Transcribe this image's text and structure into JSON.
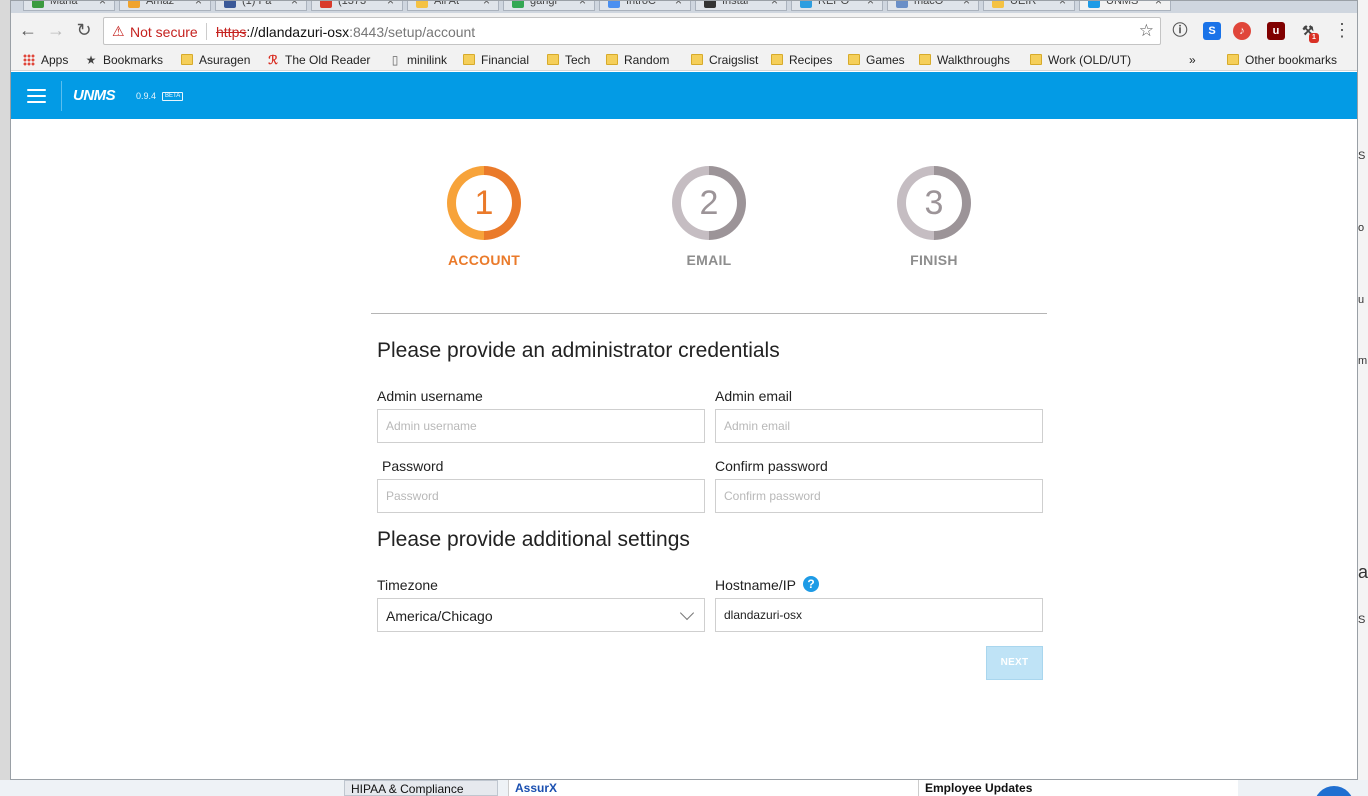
{
  "browser": {
    "tabs": [
      {
        "title": "Mana",
        "color": "#3b9b3f"
      },
      {
        "title": "Amaz",
        "color": "#f0a32c"
      },
      {
        "title": "(1) Fa",
        "color": "#3b5998"
      },
      {
        "title": "(1373",
        "color": "#d93a2b"
      },
      {
        "title": "All At",
        "color": "#f5c242"
      },
      {
        "title": "gangr",
        "color": "#34a853"
      },
      {
        "title": "IntroC",
        "color": "#4a8ff0"
      },
      {
        "title": "Instal",
        "color": "#333333"
      },
      {
        "title": "REPO",
        "color": "#2d9ee0"
      },
      {
        "title": "macO",
        "color": "#6a8fc7"
      },
      {
        "title": "UEIR",
        "color": "#f5c242"
      },
      {
        "title": "UNMS",
        "color": "#1e9be6"
      }
    ],
    "security_label": "Not secure",
    "url": {
      "protocol": "https",
      "separator": "://",
      "host": "dlandazuri-osx",
      "path": ":8443/setup/account"
    },
    "extension_badge": "1",
    "bookmarks": [
      {
        "label": "Apps",
        "icon": "apps-grid-icon"
      },
      {
        "label": "Bookmarks",
        "icon": "star-icon"
      },
      {
        "label": "Asuragen",
        "icon": "folder-icon"
      },
      {
        "label": "The Old Reader",
        "icon": "old-reader-icon"
      },
      {
        "label": "minilink",
        "icon": "page-icon"
      },
      {
        "label": "Financial",
        "icon": "folder-icon"
      },
      {
        "label": "Tech",
        "icon": "folder-icon"
      },
      {
        "label": "Random",
        "icon": "folder-icon"
      },
      {
        "label": "Craigslist",
        "icon": "folder-icon"
      },
      {
        "label": "Recipes",
        "icon": "folder-icon"
      },
      {
        "label": "Games",
        "icon": "folder-icon"
      },
      {
        "label": "Walkthroughs",
        "icon": "folder-icon"
      },
      {
        "label": "Work (OLD/UT)",
        "icon": "folder-icon"
      }
    ],
    "overflow_label": "»",
    "other_bookmarks": "Other bookmarks"
  },
  "app": {
    "logo": "UNMS",
    "version": "0.9.4",
    "beta": "BETA",
    "accent": "#039be5"
  },
  "steps": [
    {
      "number": "1",
      "label": "ACCOUNT",
      "state": "active"
    },
    {
      "number": "2",
      "label": "EMAIL",
      "state": "idle"
    },
    {
      "number": "3",
      "label": "FINISH",
      "state": "idle"
    }
  ],
  "form": {
    "heading_credentials": "Please provide an administrator credentials",
    "username_label": "Admin username",
    "username_placeholder": "Admin username",
    "email_label": "Admin email",
    "email_placeholder": "Admin email",
    "password_label": "Password",
    "password_placeholder": "Password",
    "confirm_label": "Confirm password",
    "confirm_placeholder": "Confirm password",
    "heading_settings": "Please provide additional settings",
    "timezone_label": "Timezone",
    "timezone_value": "America/Chicago",
    "hostname_label": "Hostname/IP",
    "hostname_value": "dlandazuri-osx",
    "help_glyph": "?",
    "next_label": "NEXT"
  },
  "background": {
    "items": [
      "HIPAA & Compliance",
      "AssurX",
      "Employee Updates"
    ],
    "side_chars": [
      "S",
      "o",
      "u",
      "m",
      "a",
      "S"
    ]
  }
}
